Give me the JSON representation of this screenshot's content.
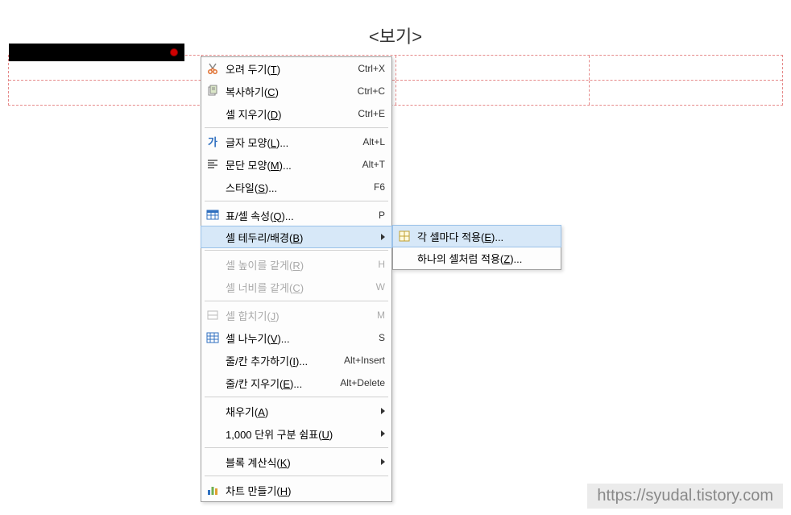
{
  "header_title": "<보기>",
  "menu": {
    "items": [
      {
        "label_pre": "오려 두기(",
        "hot": "T",
        "label_post": ")",
        "shortcut": "Ctrl+X",
        "icon": "cut-icon"
      },
      {
        "label_pre": "복사하기(",
        "hot": "C",
        "label_post": ")",
        "shortcut": "Ctrl+C",
        "icon": "copy-icon"
      },
      {
        "label_pre": "셀 지우기(",
        "hot": "D",
        "label_post": ")",
        "shortcut": "Ctrl+E"
      },
      {
        "sep": true
      },
      {
        "label_pre": "글자 모양(",
        "hot": "L",
        "label_post": ")...",
        "shortcut": "Alt+L",
        "icon": "char-icon"
      },
      {
        "label_pre": "문단 모양(",
        "hot": "M",
        "label_post": ")...",
        "shortcut": "Alt+T",
        "icon": "para-icon"
      },
      {
        "label_pre": "스타일(",
        "hot": "S",
        "label_post": ")...",
        "shortcut": "F6"
      },
      {
        "sep": true
      },
      {
        "label_pre": "표/셀 속성(",
        "hot": "Q",
        "label_post": ")...",
        "shortcut": "P",
        "icon": "table-prop-icon"
      },
      {
        "label_pre": "셀 테두리/배경(",
        "hot": "B",
        "label_post": ")",
        "arrow": true,
        "hover": true
      },
      {
        "sep": true
      },
      {
        "label_pre": "셀 높이를 같게(",
        "hot": "R",
        "label_post": ")",
        "shortcut": "H",
        "disabled": true
      },
      {
        "label_pre": "셀 너비를 같게(",
        "hot": "C",
        "label_post": ")",
        "shortcut": "W",
        "disabled": true
      },
      {
        "sep": true
      },
      {
        "label_pre": "셀 합치기(",
        "hot": "J",
        "label_post": ")",
        "shortcut": "M",
        "disabled": true,
        "icon": "merge-icon"
      },
      {
        "label_pre": "셀 나누기(",
        "hot": "V",
        "label_post": ")...",
        "shortcut": "S",
        "icon": "split-icon"
      },
      {
        "label_pre": "줄/칸 추가하기(",
        "hot": "I",
        "label_post": ")...",
        "shortcut": "Alt+Insert"
      },
      {
        "label_pre": "줄/칸 지우기(",
        "hot": "E",
        "label_post": ")...",
        "shortcut": "Alt+Delete"
      },
      {
        "sep": true
      },
      {
        "label_pre": "채우기(",
        "hot": "A",
        "label_post": ")",
        "arrow": true
      },
      {
        "label_pre": "1,000 단위 구분 쉼표(",
        "hot": "U",
        "label_post": ")",
        "arrow": true
      },
      {
        "sep": true
      },
      {
        "label_pre": "블록 계산식(",
        "hot": "K",
        "label_post": ")",
        "arrow": true
      },
      {
        "sep": true
      },
      {
        "label_pre": "차트 만들기(",
        "hot": "H",
        "label_post": ")",
        "icon": "chart-icon"
      }
    ]
  },
  "submenu": {
    "items": [
      {
        "label_pre": "각 셀마다 적용(",
        "hot": "E",
        "label_post": ")...",
        "icon": "cell-icon",
        "hover": true
      },
      {
        "label_pre": "하나의 셀처럼 적용(",
        "hot": "Z",
        "label_post": ")..."
      }
    ]
  },
  "watermark": "https://syudal.tistory.com"
}
